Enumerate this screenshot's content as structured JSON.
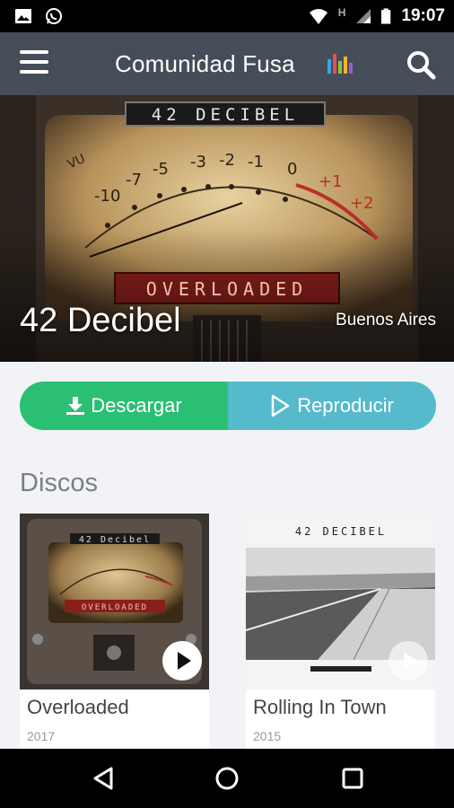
{
  "status_bar": {
    "time": "19:07",
    "network": "H"
  },
  "app_bar": {
    "title": "Comunidad Fusa"
  },
  "hero": {
    "brand_plate": "42 DECIBEL",
    "meter_label": "OVERLOADED",
    "vu_label": "VU",
    "artist_name": "42 Decibel",
    "location": "Buenos Aires"
  },
  "actions": {
    "download_label": "Descargar",
    "play_label": "Reproducir"
  },
  "albums_section": {
    "title": "Discos",
    "albums": [
      {
        "title": "Overloaded",
        "year": "2017",
        "cover_plate": "42 Decibel",
        "cover_meter": "OVERLOADED"
      },
      {
        "title": "Rolling In Town",
        "year": "2015",
        "cover_plate": "42 DECIBEL"
      }
    ]
  },
  "colors": {
    "app_bar": "#444d58",
    "download": "#2bbf73",
    "play": "#56bacc",
    "background": "#f2f3f7"
  }
}
